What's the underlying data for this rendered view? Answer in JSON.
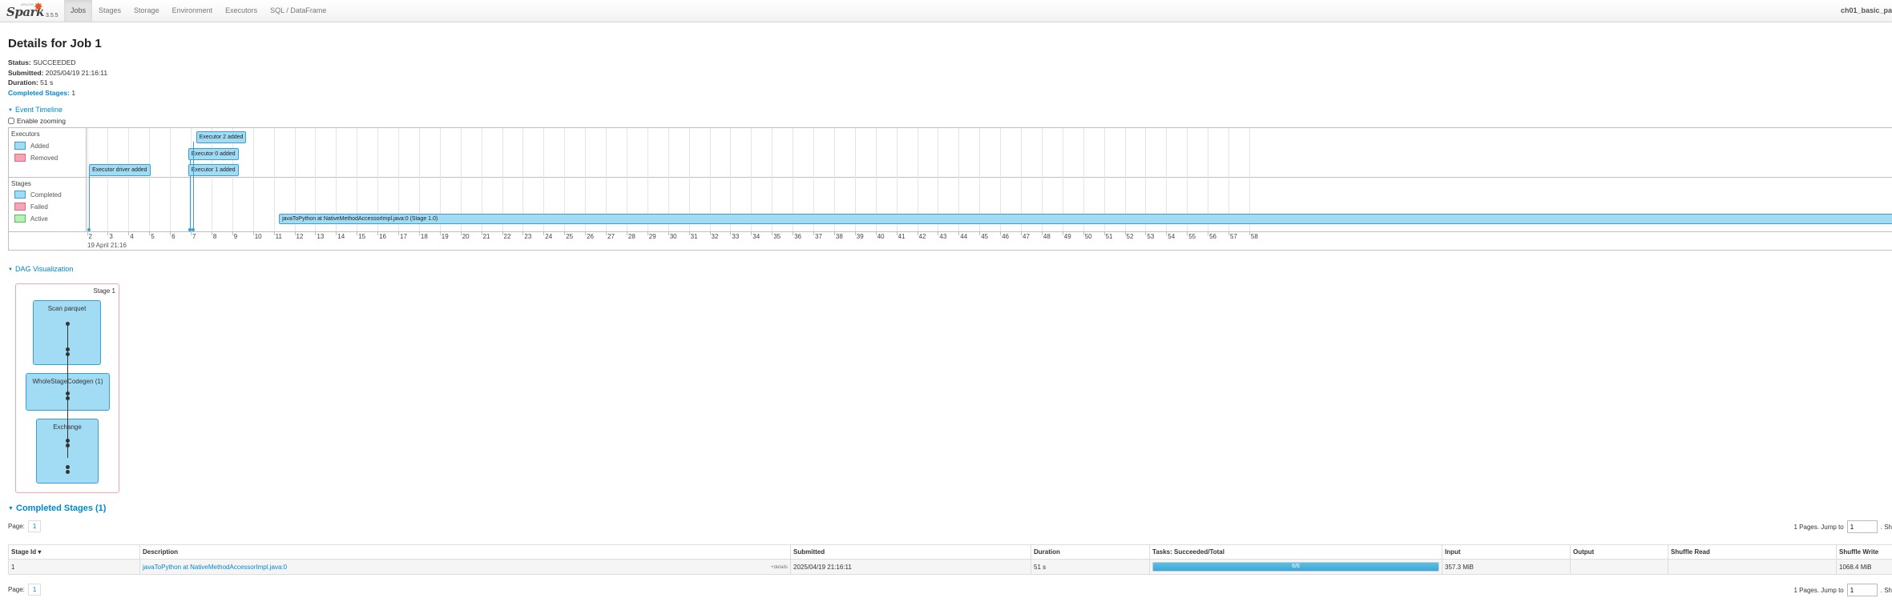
{
  "brand": {
    "name": "Spark",
    "version": "3.5.5",
    "tagline": "APACHE"
  },
  "nav": {
    "tabs": [
      {
        "id": "jobs",
        "label": "Jobs",
        "active": true
      },
      {
        "id": "stages",
        "label": "Stages"
      },
      {
        "id": "storage",
        "label": "Storage"
      },
      {
        "id": "environment",
        "label": "Environment"
      },
      {
        "id": "executors",
        "label": "Executors"
      },
      {
        "id": "sql",
        "label": "SQL / DataFrame"
      }
    ],
    "app_name": "ch01_basic_pa"
  },
  "page": {
    "title": "Details for Job 1"
  },
  "summary": {
    "status_label": "Status:",
    "status": "SUCCEEDED",
    "submitted_label": "Submitted:",
    "submitted": "2025/04/19 21:16:11",
    "duration_label": "Duration:",
    "duration": "51 s",
    "completed_stages_label": "Completed Stages:",
    "completed_stages": "1"
  },
  "timeline": {
    "toggle_label": "Event Timeline",
    "zoom_label": "Enable zooming",
    "zoom_enabled": false,
    "executors_group": "Executors",
    "executor_legend": [
      {
        "label": "Added",
        "color": "#a2dcf4"
      },
      {
        "label": "Removed",
        "color": "#f4a6b5"
      }
    ],
    "stages_group": "Stages",
    "stage_legend": [
      {
        "label": "Completed",
        "color": "#a2dcf4"
      },
      {
        "label": "Failed",
        "color": "#f4a6b5"
      },
      {
        "label": "Active",
        "color": "#b8f0b8"
      }
    ],
    "ticks": [
      "2",
      "3",
      "4",
      "5",
      "6",
      "7",
      "8",
      "9",
      "10",
      "11",
      "12",
      "13",
      "14",
      "15",
      "16",
      "17",
      "18",
      "19",
      "20",
      "21",
      "22",
      "23",
      "24",
      "25",
      "26",
      "27",
      "28",
      "29",
      "30",
      "31",
      "32",
      "33",
      "34",
      "35",
      "36",
      "37",
      "38",
      "39",
      "40",
      "41",
      "42",
      "43",
      "44",
      "45",
      "46",
      "47",
      "48",
      "49",
      "50",
      "51",
      "52",
      "53",
      "54",
      "55",
      "56",
      "57",
      "58"
    ],
    "date_label": "19 April 21:16",
    "executor_events": [
      {
        "label": "Executor driver added",
        "second": 2.1
      },
      {
        "label": "Executor 0 added",
        "second": 6.95
      },
      {
        "label": "Executor 1 added",
        "second": 6.95
      },
      {
        "label": "Executor 2 added",
        "second": 7.1
      }
    ],
    "stage_event": {
      "label": "javaToPython at NativeMethodAccessorImpl.java:0 (Stage 1.0)",
      "start_second": 11.25
    }
  },
  "dag": {
    "toggle_label": "DAG Visualization",
    "stage_label": "Stage 1",
    "nodes": [
      {
        "label": "Scan parquet"
      },
      {
        "label": "WholeStageCodegen (1)"
      },
      {
        "label": "Exchange"
      }
    ]
  },
  "completed_stages": {
    "heading": "Completed Stages (1)",
    "page_label": "Page:",
    "page_number": "1",
    "pages_text": "1 Pages. Jump to",
    "jump_value": "1",
    "show_text": ". Sh",
    "columns": [
      "Stage Id ▾",
      "Description",
      "Submitted",
      "Duration",
      "Tasks: Succeeded/Total",
      "Input",
      "Output",
      "Shuffle Read",
      "Shuffle Write"
    ],
    "rows": [
      {
        "stage_id": "1",
        "description": "javaToPython at NativeMethodAccessorImpl.java:0",
        "details": "+details",
        "submitted": "2025/04/19 21:16:11",
        "duration": "51 s",
        "tasks": "6/6",
        "tasks_fraction": 1.0,
        "input": "357.3 MiB",
        "output": "",
        "shuffle_read": "",
        "shuffle_write": "1068.4 MiB"
      }
    ]
  }
}
